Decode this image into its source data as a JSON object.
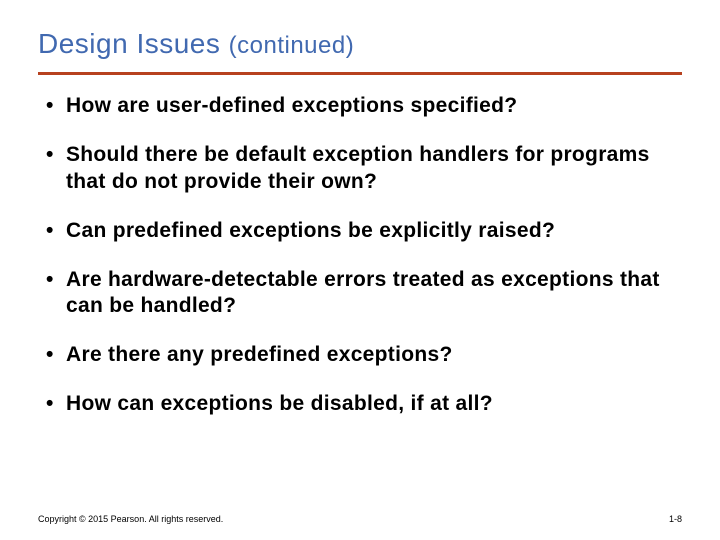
{
  "title_main": "Design Issues ",
  "title_sub": "(continued)",
  "bullets": [
    "How are user-defined exceptions specified?",
    "Should there be default exception handlers for programs that do not provide their own?",
    "Can predefined exceptions be explicitly raised?",
    "Are hardware-detectable errors treated as exceptions that can be handled?",
    "Are there any predefined exceptions?",
    "How can exceptions be disabled, if at all?"
  ],
  "footer_left": "Copyright © 2015 Pearson. All rights reserved.",
  "footer_right": "1-8"
}
